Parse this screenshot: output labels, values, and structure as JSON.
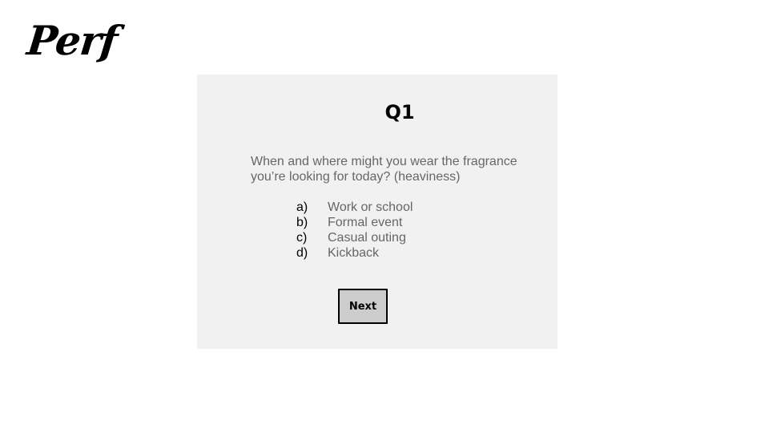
{
  "brand": {
    "logo_text": "Perf"
  },
  "quiz": {
    "question_number": "Q1",
    "question_text": "When and where might you wear the fragrance you’re looking for today? (heaviness)",
    "options": [
      {
        "letter": "a)",
        "label": "Work or school"
      },
      {
        "letter": "b)",
        "label": "Formal event"
      },
      {
        "letter": "c)",
        "label": "Casual outing"
      },
      {
        "letter": "d)",
        "label": "Kickback"
      }
    ],
    "next_label": "Next"
  },
  "colors": {
    "card_background": "#f1f1f1",
    "muted_text": "#666666",
    "button_background": "#cccccc",
    "text": "#000000"
  }
}
